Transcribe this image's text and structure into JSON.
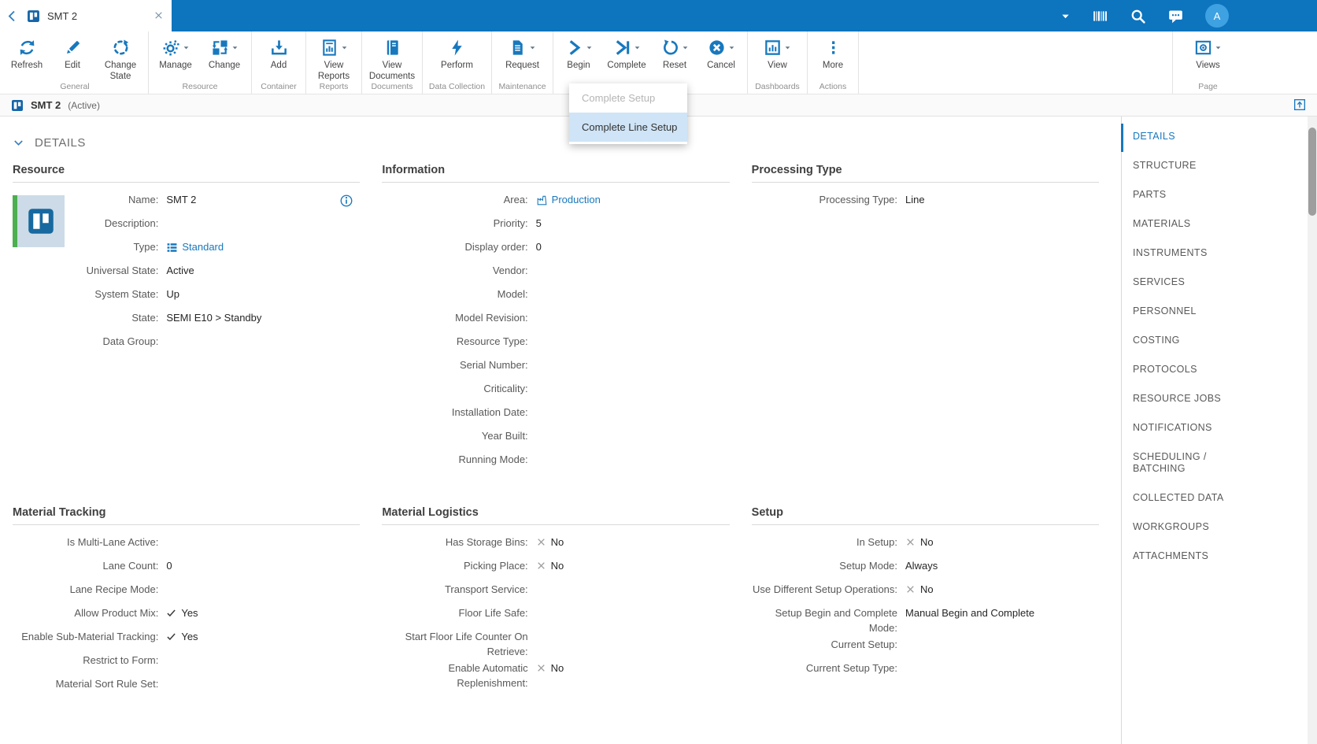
{
  "colors": {
    "topbar_blue": "#0d74be",
    "accent_blue": "#1878be",
    "avatar_blue": "#3ea1e2",
    "dropdown_highlight": "#cfe4f6",
    "thumbnail_green": "#4caf50"
  },
  "topbar": {
    "tab_title": "SMT 2",
    "avatar_initial": "A",
    "icons": [
      "back-chevron-icon",
      "board-icon",
      "close-icon",
      "caret-down-icon",
      "barcode-icon",
      "search-icon",
      "chat-icon",
      "avatar"
    ]
  },
  "ribbon": {
    "groups": [
      {
        "label": "General",
        "buttons": [
          {
            "label": "Refresh"
          },
          {
            "label": "Edit"
          },
          {
            "label": "Change State"
          }
        ]
      },
      {
        "label": "Resource",
        "buttons": [
          {
            "label": "Manage",
            "caret": true
          },
          {
            "label": "Change",
            "caret": true
          }
        ]
      },
      {
        "label": "Container",
        "buttons": [
          {
            "label": "Add"
          }
        ]
      },
      {
        "label": "Reports",
        "buttons": [
          {
            "label": "View Reports",
            "caret": true
          }
        ]
      },
      {
        "label": "Documents",
        "buttons": [
          {
            "label": "View Documents"
          }
        ]
      },
      {
        "label": "Data Collection",
        "buttons": [
          {
            "label": "Perform"
          }
        ]
      },
      {
        "label": "Maintenance",
        "buttons": [
          {
            "label": "Request",
            "caret": true
          }
        ]
      },
      {
        "label": "",
        "buttons": [
          {
            "label": "Begin",
            "caret": true
          },
          {
            "label": "Complete",
            "caret": true
          },
          {
            "label": "Reset",
            "caret": true
          },
          {
            "label": "Cancel",
            "caret": true
          }
        ]
      },
      {
        "label": "Dashboards",
        "buttons": [
          {
            "label": "View",
            "caret": true
          }
        ]
      },
      {
        "label": "Actions",
        "buttons": [
          {
            "label": "More"
          }
        ]
      },
      {
        "label": "Page",
        "buttons": [
          {
            "label": "Views",
            "caret": true
          }
        ]
      }
    ]
  },
  "dropdown": {
    "items": [
      {
        "label": "Complete Setup",
        "disabled": true
      },
      {
        "label": "Complete Line Setup",
        "highlighted": true
      }
    ]
  },
  "entity": {
    "name": "SMT 2",
    "state": "(Active)"
  },
  "details_header": {
    "label": "DETAILS"
  },
  "panels": {
    "resource": {
      "title": "Resource",
      "rows": [
        {
          "label": "Name:",
          "value": "SMT 2"
        },
        {
          "label": "Description:",
          "value": ""
        },
        {
          "label": "Type:",
          "value": "Standard",
          "link": true,
          "icon": "type-list-icon"
        },
        {
          "label": "Universal State:",
          "value": "Active"
        },
        {
          "label": "System State:",
          "value": "Up"
        },
        {
          "label": "State:",
          "value": "SEMI E10 > Standby"
        },
        {
          "label": "Data Group:",
          "value": ""
        }
      ]
    },
    "information": {
      "title": "Information",
      "rows": [
        {
          "label": "Area:",
          "value": "Production",
          "link": true,
          "icon": "factory-icon"
        },
        {
          "label": "Priority:",
          "value": "5"
        },
        {
          "label": "Display order:",
          "value": "0"
        },
        {
          "label": "Vendor:",
          "value": ""
        },
        {
          "label": "Model:",
          "value": ""
        },
        {
          "label": "Model Revision:",
          "value": ""
        },
        {
          "label": "Resource Type:",
          "value": ""
        },
        {
          "label": "Serial Number:",
          "value": ""
        },
        {
          "label": "Criticality:",
          "value": ""
        },
        {
          "label": "Installation Date:",
          "value": ""
        },
        {
          "label": "Year Built:",
          "value": ""
        },
        {
          "label": "Running Mode:",
          "value": ""
        }
      ]
    },
    "processing_type": {
      "title": "Processing Type",
      "rows": [
        {
          "label": "Processing Type:",
          "value": "Line"
        }
      ]
    },
    "material_tracking": {
      "title": "Material Tracking",
      "rows": [
        {
          "label": "Is Multi-Lane Active:",
          "value": ""
        },
        {
          "label": "Lane Count:",
          "value": "0"
        },
        {
          "label": "Lane Recipe Mode:",
          "value": ""
        },
        {
          "label": "Allow Product Mix:",
          "value": "Yes",
          "mark": "check"
        },
        {
          "label": "Enable Sub-Material Tracking:",
          "value": "Yes",
          "mark": "check"
        },
        {
          "label": "Restrict to Form:",
          "value": ""
        },
        {
          "label": "Material Sort Rule Set:",
          "value": ""
        }
      ]
    },
    "material_logistics": {
      "title": "Material Logistics",
      "rows": [
        {
          "label": "Has Storage Bins:",
          "value": "No",
          "mark": "cross"
        },
        {
          "label": "Picking Place:",
          "value": "No",
          "mark": "cross"
        },
        {
          "label": "Transport Service:",
          "value": ""
        },
        {
          "label": "Floor Life Safe:",
          "value": ""
        },
        {
          "label": "Start Floor Life Counter On Retrieve:",
          "value": ""
        },
        {
          "label": "Enable Automatic Replenishment:",
          "value": "No",
          "mark": "cross"
        }
      ]
    },
    "setup": {
      "title": "Setup",
      "rows": [
        {
          "label": "In Setup:",
          "value": "No",
          "mark": "cross"
        },
        {
          "label": "Setup Mode:",
          "value": "Always"
        },
        {
          "label": "Use Different Setup Operations:",
          "value": "No",
          "mark": "cross"
        },
        {
          "label": "Setup Begin and Complete Mode:",
          "value": "Manual Begin and Complete"
        },
        {
          "label": "Current Setup:",
          "value": ""
        },
        {
          "label": "Current Setup Type:",
          "value": ""
        }
      ]
    }
  },
  "sidebar": {
    "items": [
      {
        "label": "DETAILS",
        "active": true
      },
      {
        "label": "STRUCTURE"
      },
      {
        "label": "PARTS"
      },
      {
        "label": "MATERIALS"
      },
      {
        "label": "INSTRUMENTS"
      },
      {
        "label": "SERVICES"
      },
      {
        "label": "PERSONNEL"
      },
      {
        "label": "COSTING"
      },
      {
        "label": "PROTOCOLS"
      },
      {
        "label": "RESOURCE JOBS"
      },
      {
        "label": "NOTIFICATIONS"
      },
      {
        "label": "SCHEDULING / BATCHING"
      },
      {
        "label": "COLLECTED DATA"
      },
      {
        "label": "WORKGROUPS"
      },
      {
        "label": "ATTACHMENTS"
      }
    ]
  }
}
